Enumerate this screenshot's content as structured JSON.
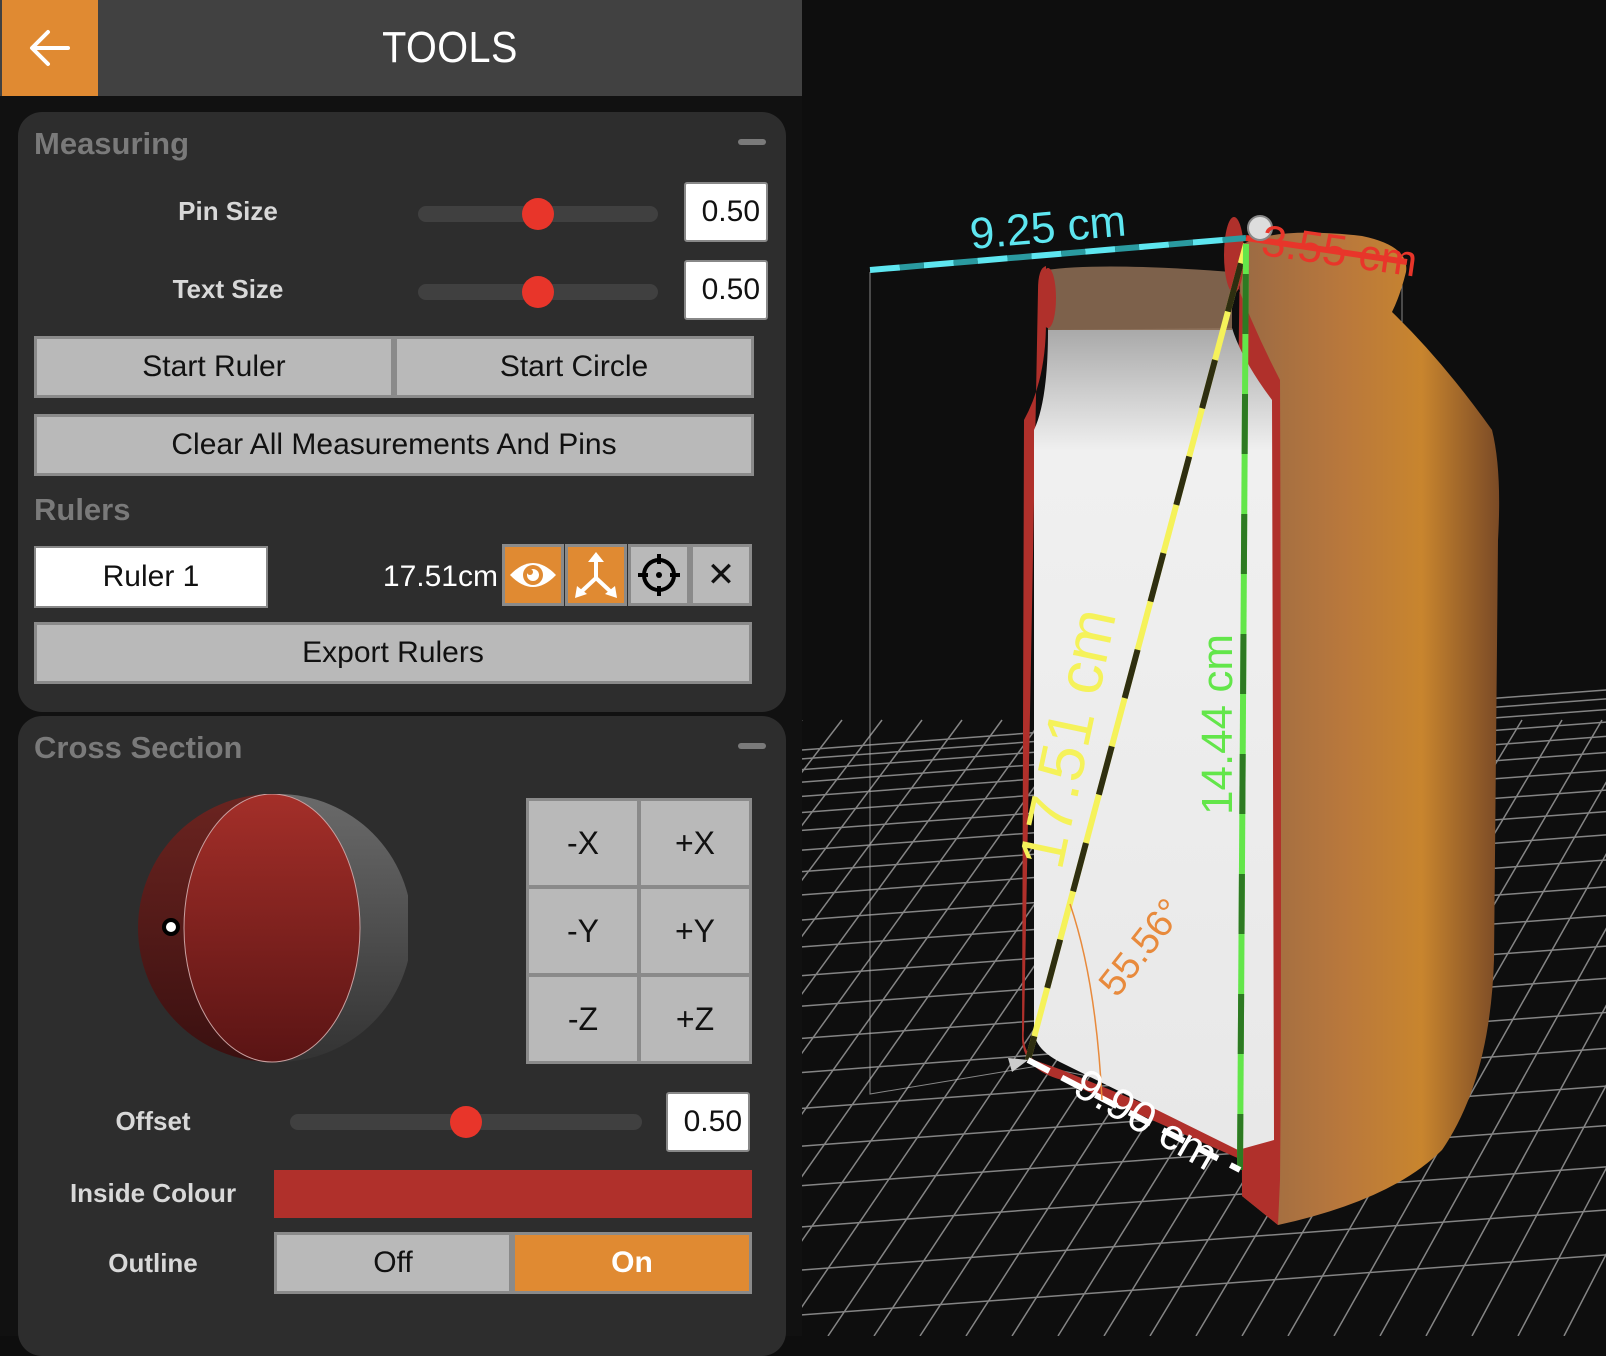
{
  "header": {
    "title": "TOOLS",
    "back_icon": "arrow-left-icon"
  },
  "measuring": {
    "title": "Measuring",
    "pin_size": {
      "label": "Pin Size",
      "value": "0.50",
      "fraction": 0.5
    },
    "text_size": {
      "label": "Text Size",
      "value": "0.50",
      "fraction": 0.5
    },
    "start_ruler_label": "Start Ruler",
    "start_circle_label": "Start Circle",
    "clear_all_label": "Clear All Measurements And Pins",
    "rulers_heading": "Rulers",
    "rulers": [
      {
        "name": "Ruler 1",
        "length": "17.51cm",
        "icons": [
          "eye-icon",
          "axes-icon",
          "crosshair-icon",
          "close-icon"
        ],
        "close_glyph": "✕"
      }
    ],
    "export_label": "Export Rulers"
  },
  "cross_section": {
    "title": "Cross Section",
    "axis_buttons": [
      "-X",
      "+X",
      "-Y",
      "+Y",
      "-Z",
      "+Z"
    ],
    "offset": {
      "label": "Offset",
      "value": "0.50",
      "fraction": 0.5
    },
    "inside_colour": {
      "label": "Inside Colour",
      "color": "#b0302b"
    },
    "outline": {
      "label": "Outline",
      "options": [
        "Off",
        "On"
      ],
      "selected": "On"
    }
  },
  "viewport": {
    "measurements": [
      {
        "text": "9.25 cm",
        "color": "#5ee6f0"
      },
      {
        "text": "3.55 cm",
        "color": "#e8352a"
      },
      {
        "text": "17.51 cm",
        "color": "#f5f25a"
      },
      {
        "text": "14.44 cm",
        "color": "#63e64a"
      },
      {
        "text": "55.56°",
        "color": "#e88a3c"
      },
      {
        "text": "9.90 cm",
        "color": "#ffffff"
      }
    ]
  },
  "colors": {
    "accent": "#e08a32",
    "slider_thumb": "#e8352a",
    "panel_bg": "#2d2d2d",
    "header_bg": "#414141"
  }
}
